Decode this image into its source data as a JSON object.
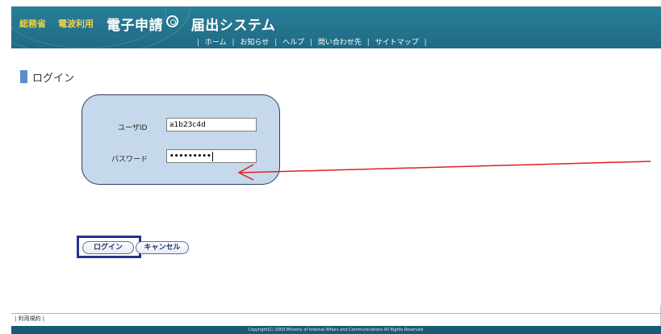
{
  "header": {
    "ministry_label": "総務省",
    "ministry_sub": "電波利用",
    "system_title": "電子申請",
    "system_title2": "届出システム"
  },
  "topnav": {
    "items": [
      "ホーム",
      "お知らせ",
      "ヘルプ",
      "問い合わせ先",
      "サイトマップ"
    ]
  },
  "page": {
    "title": "ログイン"
  },
  "login": {
    "user_id_label": "ユーザID",
    "user_id_value": "a1b23c4d",
    "password_label": "パスワード",
    "password_value": "•••••••••"
  },
  "buttons": {
    "login": "ログイン",
    "cancel": "キャンセル"
  },
  "footer": {
    "terms_link": "| 利用規約 |",
    "copyright": "Copyright(C) 2003 Ministry of Internal Affairs and Communications All Rights Reserved."
  },
  "colors": {
    "header": "#1f6a84",
    "panel": "#c6d9ec",
    "highlight": "#29328e",
    "arrow": "#e02020"
  },
  "icons": {
    "logo": "ring-logo-icon",
    "title_marker": "title-bar-icon",
    "arrow": "annotation-arrow"
  }
}
